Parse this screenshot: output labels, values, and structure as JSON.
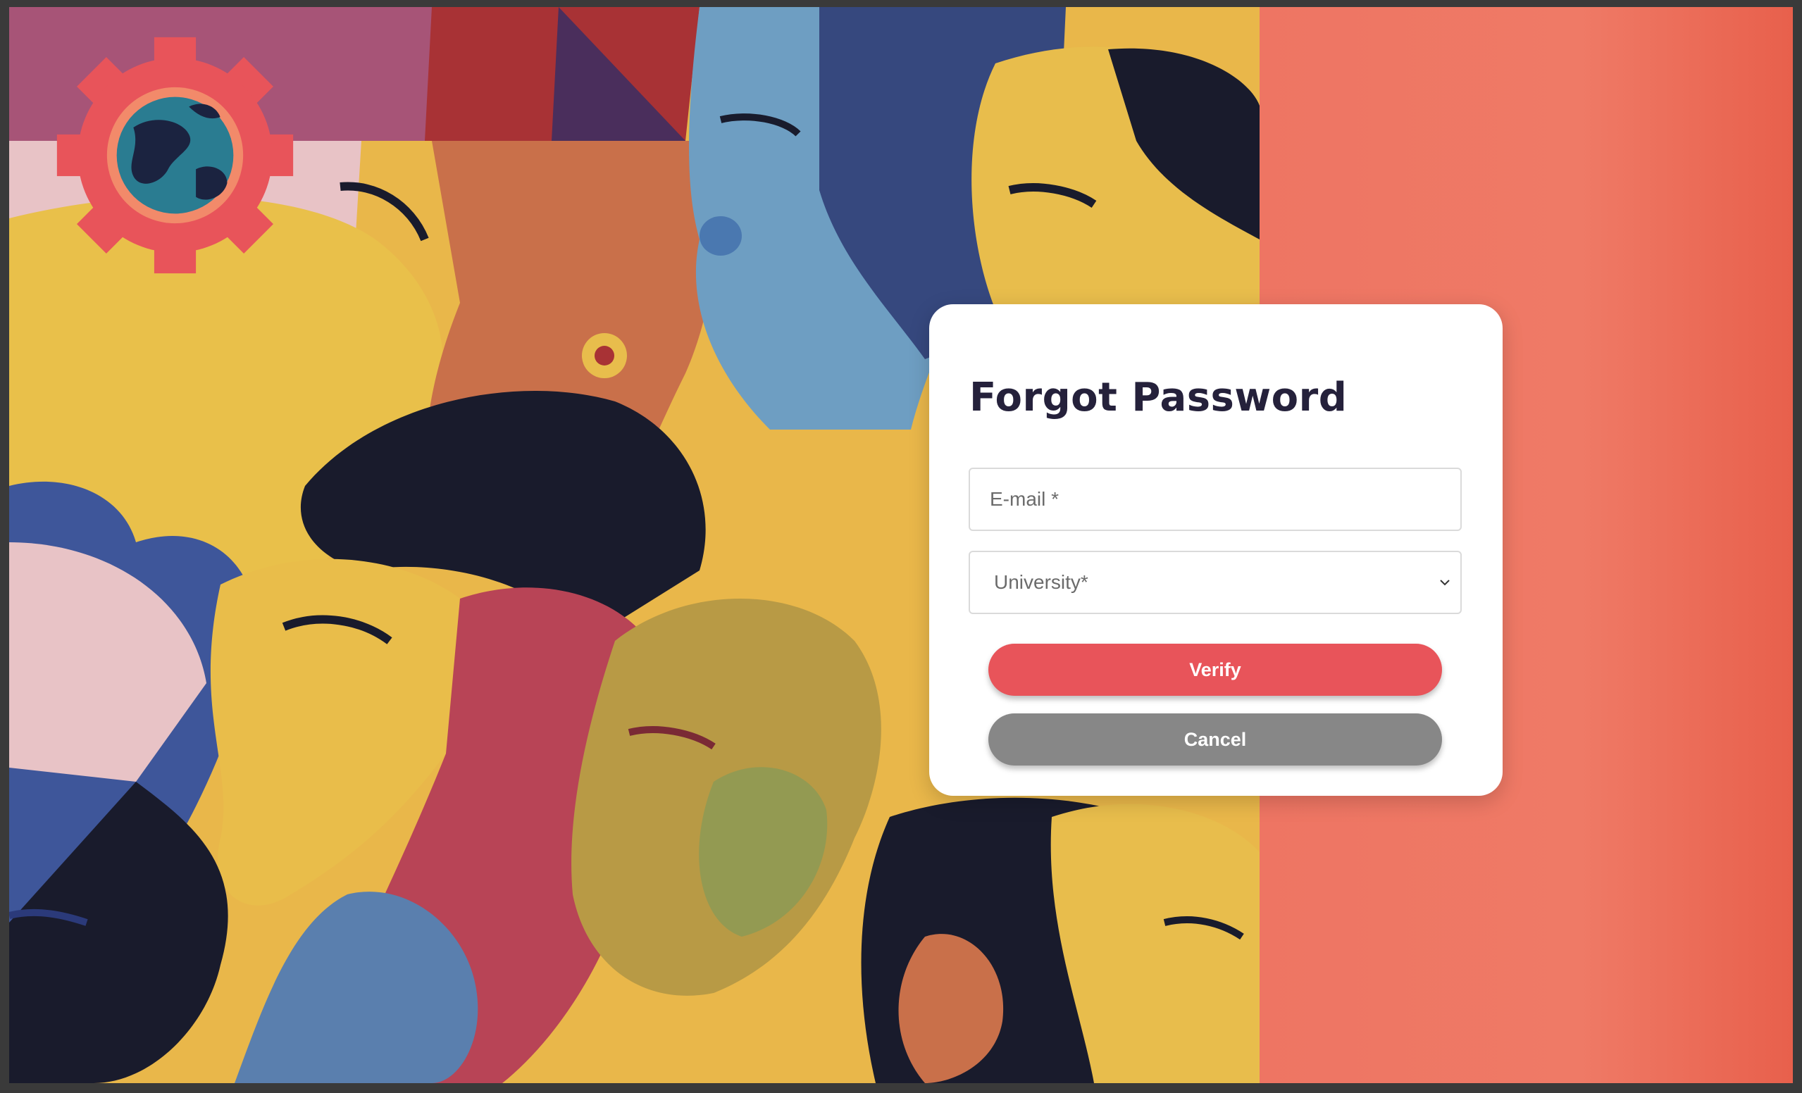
{
  "colors": {
    "page_background": "#ee7563",
    "card_background": "#ffffff",
    "title_color": "#25213b",
    "verify_button": "#e8545a",
    "cancel_button": "#878787",
    "logo_gear": "#e8545a",
    "logo_globe": "#2a7c91"
  },
  "icons": {
    "logo": "gear-globe-logo-icon",
    "select_arrow": "chevron-down-icon"
  },
  "form": {
    "title": "Forgot Password",
    "email_placeholder": "E-mail *",
    "university_placeholder": "University*",
    "verify_label": "Verify",
    "cancel_label": "Cancel"
  }
}
